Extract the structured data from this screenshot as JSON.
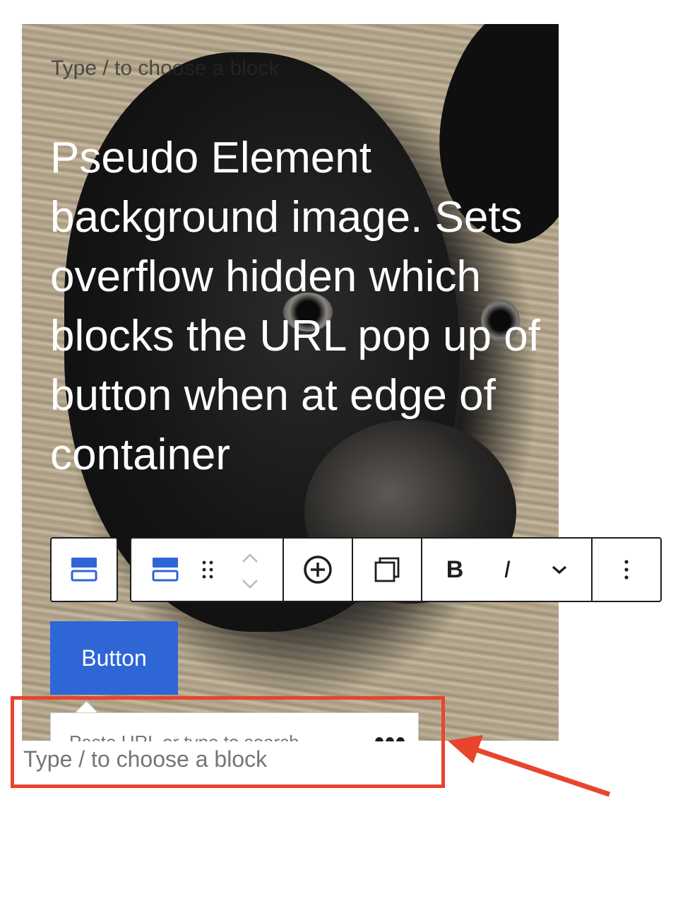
{
  "cover": {
    "placeholder_top": "Type / to choose a block",
    "heading": "Pseudo Element background image. Sets overflow hidden which blocks the URL pop up of button when at edge of container"
  },
  "toolbar": {
    "buttons": [
      {
        "name": "block-type",
        "icon": "buttons-block-icon"
      },
      {
        "name": "parent-block",
        "icon": "button-block-icon"
      },
      {
        "name": "drag-handle",
        "icon": "drag-handle-icon"
      },
      {
        "name": "move-up",
        "icon": "chevron-up-icon"
      },
      {
        "name": "move-down",
        "icon": "chevron-down-icon"
      },
      {
        "name": "link",
        "icon": "plus-circle-icon"
      },
      {
        "name": "duplicate",
        "icon": "duplicate-icon"
      },
      {
        "name": "bold",
        "label": "B"
      },
      {
        "name": "italic",
        "label": "I"
      },
      {
        "name": "more-formatting",
        "icon": "chevron-down-icon"
      },
      {
        "name": "options",
        "icon": "kebab-icon"
      }
    ],
    "bold_label": "B",
    "italic_label": "I"
  },
  "button_block": {
    "label": "Button"
  },
  "link_popover": {
    "placeholder": "Paste URL or type to search",
    "more_label": "•••"
  },
  "inserter": {
    "placeholder_bottom": "Type / to choose a block"
  },
  "annotation": {
    "color": "#e8442e"
  }
}
